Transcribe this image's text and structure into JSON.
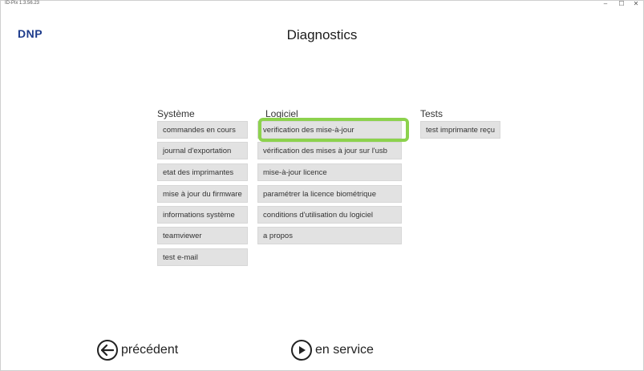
{
  "window": {
    "title": "ID-Pix 1.3.56.23",
    "controls": {
      "minimize": "–",
      "maximize": "☐",
      "close": "✕"
    }
  },
  "logo_text": "DNP",
  "page_title": "Diagnostics",
  "columns": {
    "systeme": {
      "title": "Système",
      "items": [
        "commandes en cours",
        "journal d'exportation",
        "etat des imprimantes",
        "mise à jour du firmware",
        "informations système",
        "teamviewer",
        "test e-mail"
      ]
    },
    "logiciel": {
      "title": "Logiciel",
      "items": [
        "verification des mise-à-jour",
        "vérification des mises à jour sur l'usb",
        "mise-à-jour licence",
        "paramétrer la licence biométrique",
        "conditions d'utilisation du logiciel",
        "a propos"
      ]
    },
    "tests": {
      "title": "Tests",
      "items": [
        "test imprimante reçu"
      ]
    }
  },
  "nav": {
    "back_label": "précédent",
    "back_icon": "left-arrow-circle-icon",
    "service_label": "en service",
    "service_icon": "play-circle-icon"
  },
  "colors": {
    "logo": "#1e3c8c",
    "highlight": "#8cd24d",
    "button_bg": "#e2e2e2"
  }
}
